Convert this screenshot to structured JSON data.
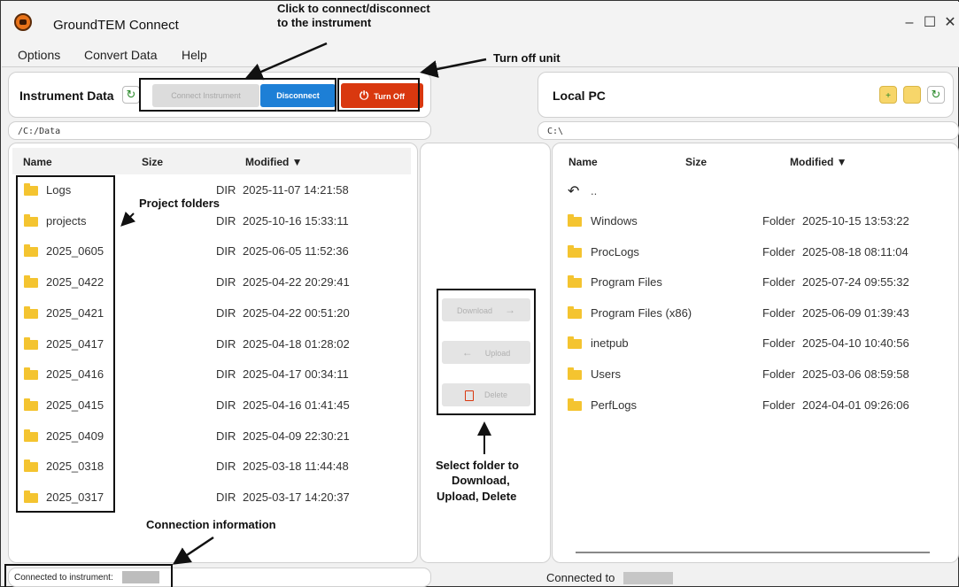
{
  "window": {
    "title": "GroundTEM Connect",
    "controls": {
      "minimize": "–",
      "maximize": "☐",
      "close": "✕"
    }
  },
  "menu": [
    "Options",
    "Convert Data",
    "Help"
  ],
  "instrument_panel": {
    "title": "Instrument Data",
    "connect_label": "Connect Instrument",
    "disconnect_label": "Disconnect",
    "turnoff_label": "Turn Off",
    "path": "/C:/Data",
    "columns": {
      "name": "Name",
      "size": "Size",
      "modified": "Modified ▼"
    },
    "rows": [
      {
        "name": "Logs",
        "size": "DIR",
        "modified": "2025-11-07 14:21:58"
      },
      {
        "name": "projects",
        "size": "DIR",
        "modified": "2025-10-16 15:33:11"
      },
      {
        "name": "2025_0605",
        "size": "DIR",
        "modified": "2025-06-05 11:52:36"
      },
      {
        "name": "2025_0422",
        "size": "DIR",
        "modified": "2025-04-22 20:29:41"
      },
      {
        "name": "2025_0421",
        "size": "DIR",
        "modified": "2025-04-22 00:51:20"
      },
      {
        "name": "2025_0417",
        "size": "DIR",
        "modified": "2025-04-18 01:28:02"
      },
      {
        "name": "2025_0416",
        "size": "DIR",
        "modified": "2025-04-17 00:34:11"
      },
      {
        "name": "2025_0415",
        "size": "DIR",
        "modified": "2025-04-16 01:41:45"
      },
      {
        "name": "2025_0409",
        "size": "DIR",
        "modified": "2025-04-09 22:30:21"
      },
      {
        "name": "2025_0318",
        "size": "DIR",
        "modified": "2025-03-18 11:44:48"
      },
      {
        "name": "2025_0317",
        "size": "DIR",
        "modified": "2025-03-17 14:20:37"
      }
    ],
    "status": "Connected to instrument:"
  },
  "transfer": {
    "download_label": "Download",
    "upload_label": "Upload",
    "delete_label": "Delete"
  },
  "local_panel": {
    "title": "Local PC",
    "path": "C:\\",
    "columns": {
      "name": "Name",
      "size": "Size",
      "modified": "Modified ▼"
    },
    "parent": "..",
    "rows": [
      {
        "name": "Windows",
        "size": "Folder",
        "modified": "2025-10-15 13:53:22"
      },
      {
        "name": "ProcLogs",
        "size": "Folder",
        "modified": "2025-08-18 08:11:04"
      },
      {
        "name": "Program Files",
        "size": "Folder",
        "modified": "2025-07-24 09:55:32"
      },
      {
        "name": "Program Files (x86)",
        "size": "Folder",
        "modified": "2025-06-09 01:39:43"
      },
      {
        "name": "inetpub",
        "size": "Folder",
        "modified": "2025-04-10 10:40:56"
      },
      {
        "name": "Users",
        "size": "Folder",
        "modified": "2025-03-06 08:59:58"
      },
      {
        "name": "PerfLogs",
        "size": "Folder",
        "modified": "2024-04-01 09:26:06"
      }
    ],
    "status": "Connected to"
  },
  "annotations": {
    "connect": "Click to connect/disconnect",
    "connect2": "to the instrument",
    "turnoff": "Turn off unit",
    "projects": "Project folders",
    "connection": "Connection information",
    "select1": "Select folder to",
    "select2": "Download,",
    "select3": "Upload, Delete"
  },
  "colors": {
    "accent": "#1d7fd6",
    "danger": "#d9380f",
    "folder": "#f4c430"
  },
  "icons": [
    "app-logo-icon",
    "refresh-icon",
    "power-icon",
    "folder-add-icon",
    "folder-icon",
    "back-arrow-icon",
    "trash-icon"
  ]
}
